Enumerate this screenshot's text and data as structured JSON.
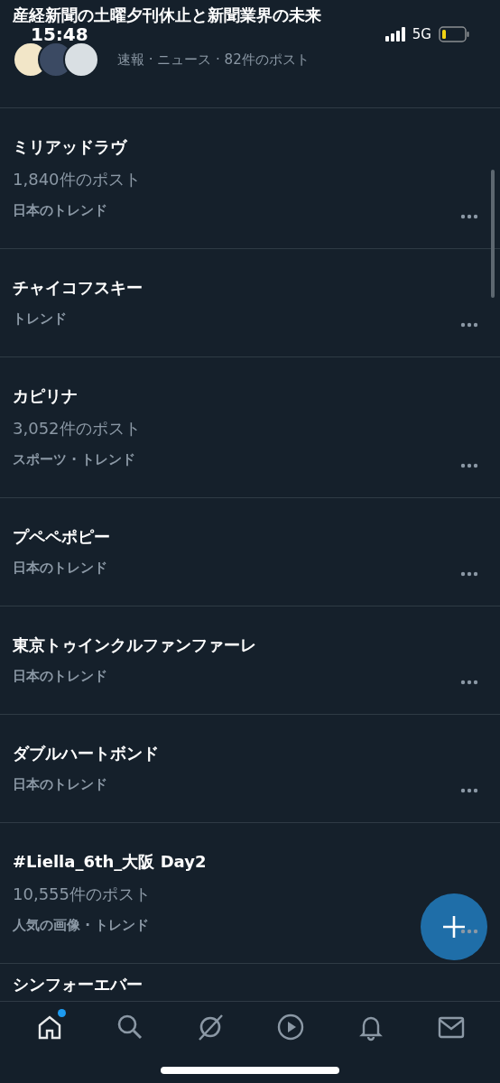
{
  "status_bar": {
    "time": "15:48",
    "network": "5G"
  },
  "header": {
    "title": "産経新聞の土曜夕刊休止と新聞業界の未来",
    "subtitle": "速報 · ニュース · 82件のポスト"
  },
  "trends": [
    {
      "title": "ミリアッドラヴ",
      "count": "1,840件のポスト",
      "meta": "日本のトレンド"
    },
    {
      "title": "チャイコフスキー",
      "meta": "トレンド"
    },
    {
      "title": "カピリナ",
      "count": "3,052件のポスト",
      "meta": "スポーツ · トレンド"
    },
    {
      "title": "プペペポピー",
      "meta": "日本のトレンド"
    },
    {
      "title": "東京トゥインクルファンファーレ",
      "meta": "日本のトレンド"
    },
    {
      "title": "ダブルハートボンド",
      "meta": "日本のトレンド"
    },
    {
      "title": "#Liella_6th_大阪 Day2",
      "count": "10,555件のポスト",
      "meta": "人気の画像 · トレンド"
    },
    {
      "title": "シンフォーエバー"
    }
  ],
  "bottom_nav": [
    {
      "kind": "home",
      "selected": true,
      "badge": true
    },
    {
      "kind": "search",
      "selected": false,
      "badge": false
    },
    {
      "kind": "slash",
      "selected": false,
      "badge": false
    },
    {
      "kind": "play",
      "selected": false,
      "badge": false
    },
    {
      "kind": "bell",
      "selected": false,
      "badge": false
    },
    {
      "kind": "mail",
      "selected": false,
      "badge": false
    }
  ]
}
